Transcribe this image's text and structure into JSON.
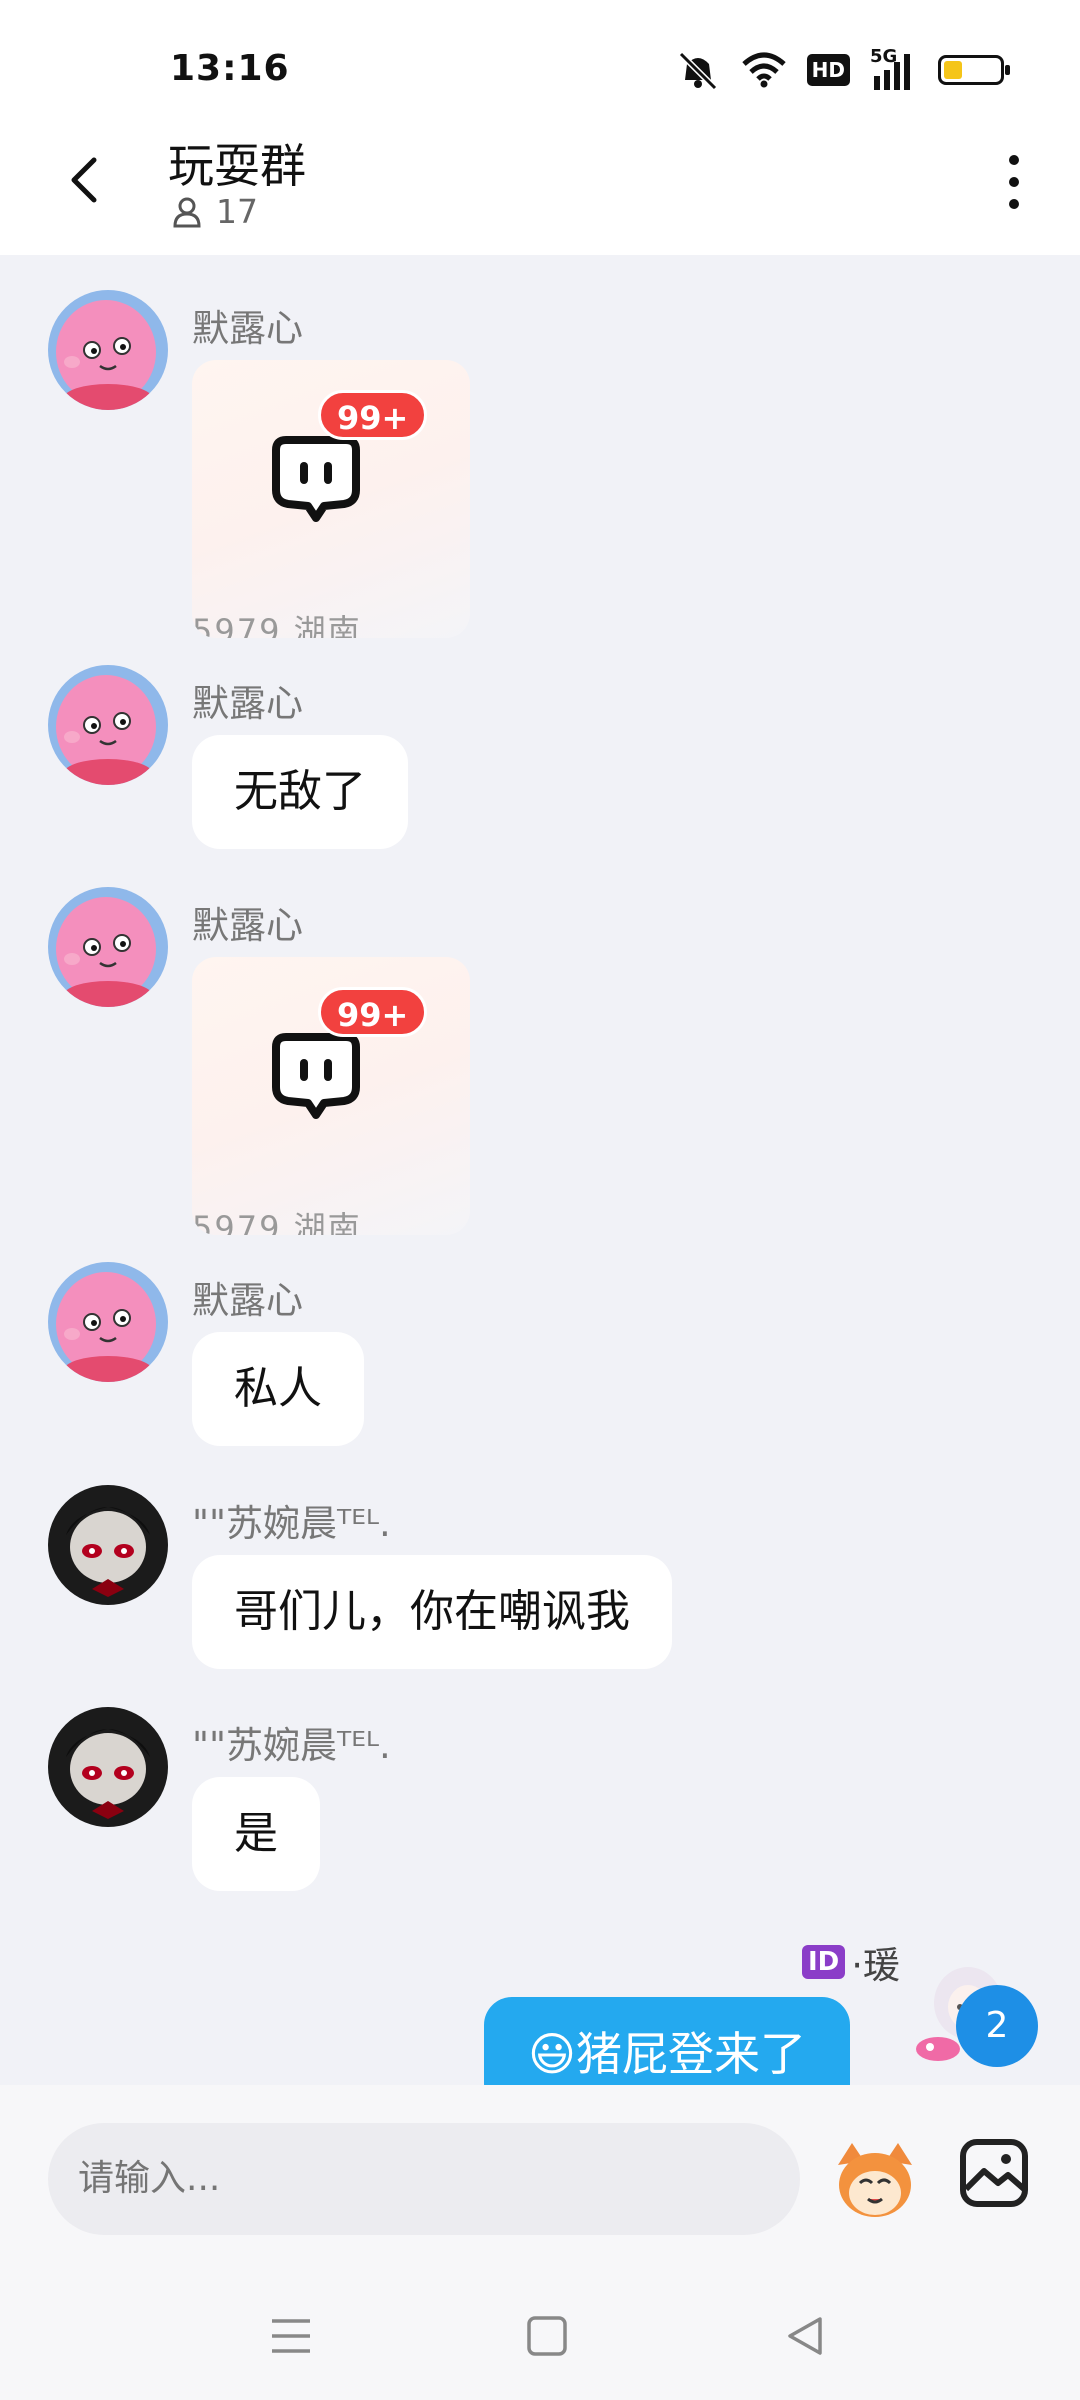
{
  "status_bar": {
    "time": "13:16",
    "network": "5G",
    "hd": "HD"
  },
  "header": {
    "title": "玩耍群",
    "member_count": "17"
  },
  "messages": [
    {
      "sender": "默露心",
      "type": "card",
      "card_badge": "99+",
      "card_footer": "5979 湖南"
    },
    {
      "sender": "默露心",
      "type": "text",
      "text": "无敌了"
    },
    {
      "sender": "默露心",
      "type": "card",
      "card_badge": "99+",
      "card_footer": "5979 湖南"
    },
    {
      "sender": "默露心",
      "type": "text",
      "text": "私人"
    },
    {
      "sender": "\"\"苏婉晨ᵀᴱᴸ.",
      "type": "text",
      "text": "哥们儿，你在嘲讽我"
    },
    {
      "sender": "\"\"苏婉晨ᵀᴱᴸ.",
      "type": "text",
      "text": "是"
    }
  ],
  "self_message": {
    "sender_badge": "ID",
    "sender": "·瑗",
    "text": "😃猪屁登来了",
    "unread_count": "2"
  },
  "input": {
    "placeholder": "请输入..."
  },
  "colors": {
    "accent": "#24a9ef",
    "badge": "#f2413f",
    "background": "#f1f2f7"
  },
  "icons": {
    "back": "chevron-left-icon",
    "more": "more-vertical-icon",
    "member": "person-icon",
    "emoji": "sticker-icon",
    "image": "image-icon"
  }
}
